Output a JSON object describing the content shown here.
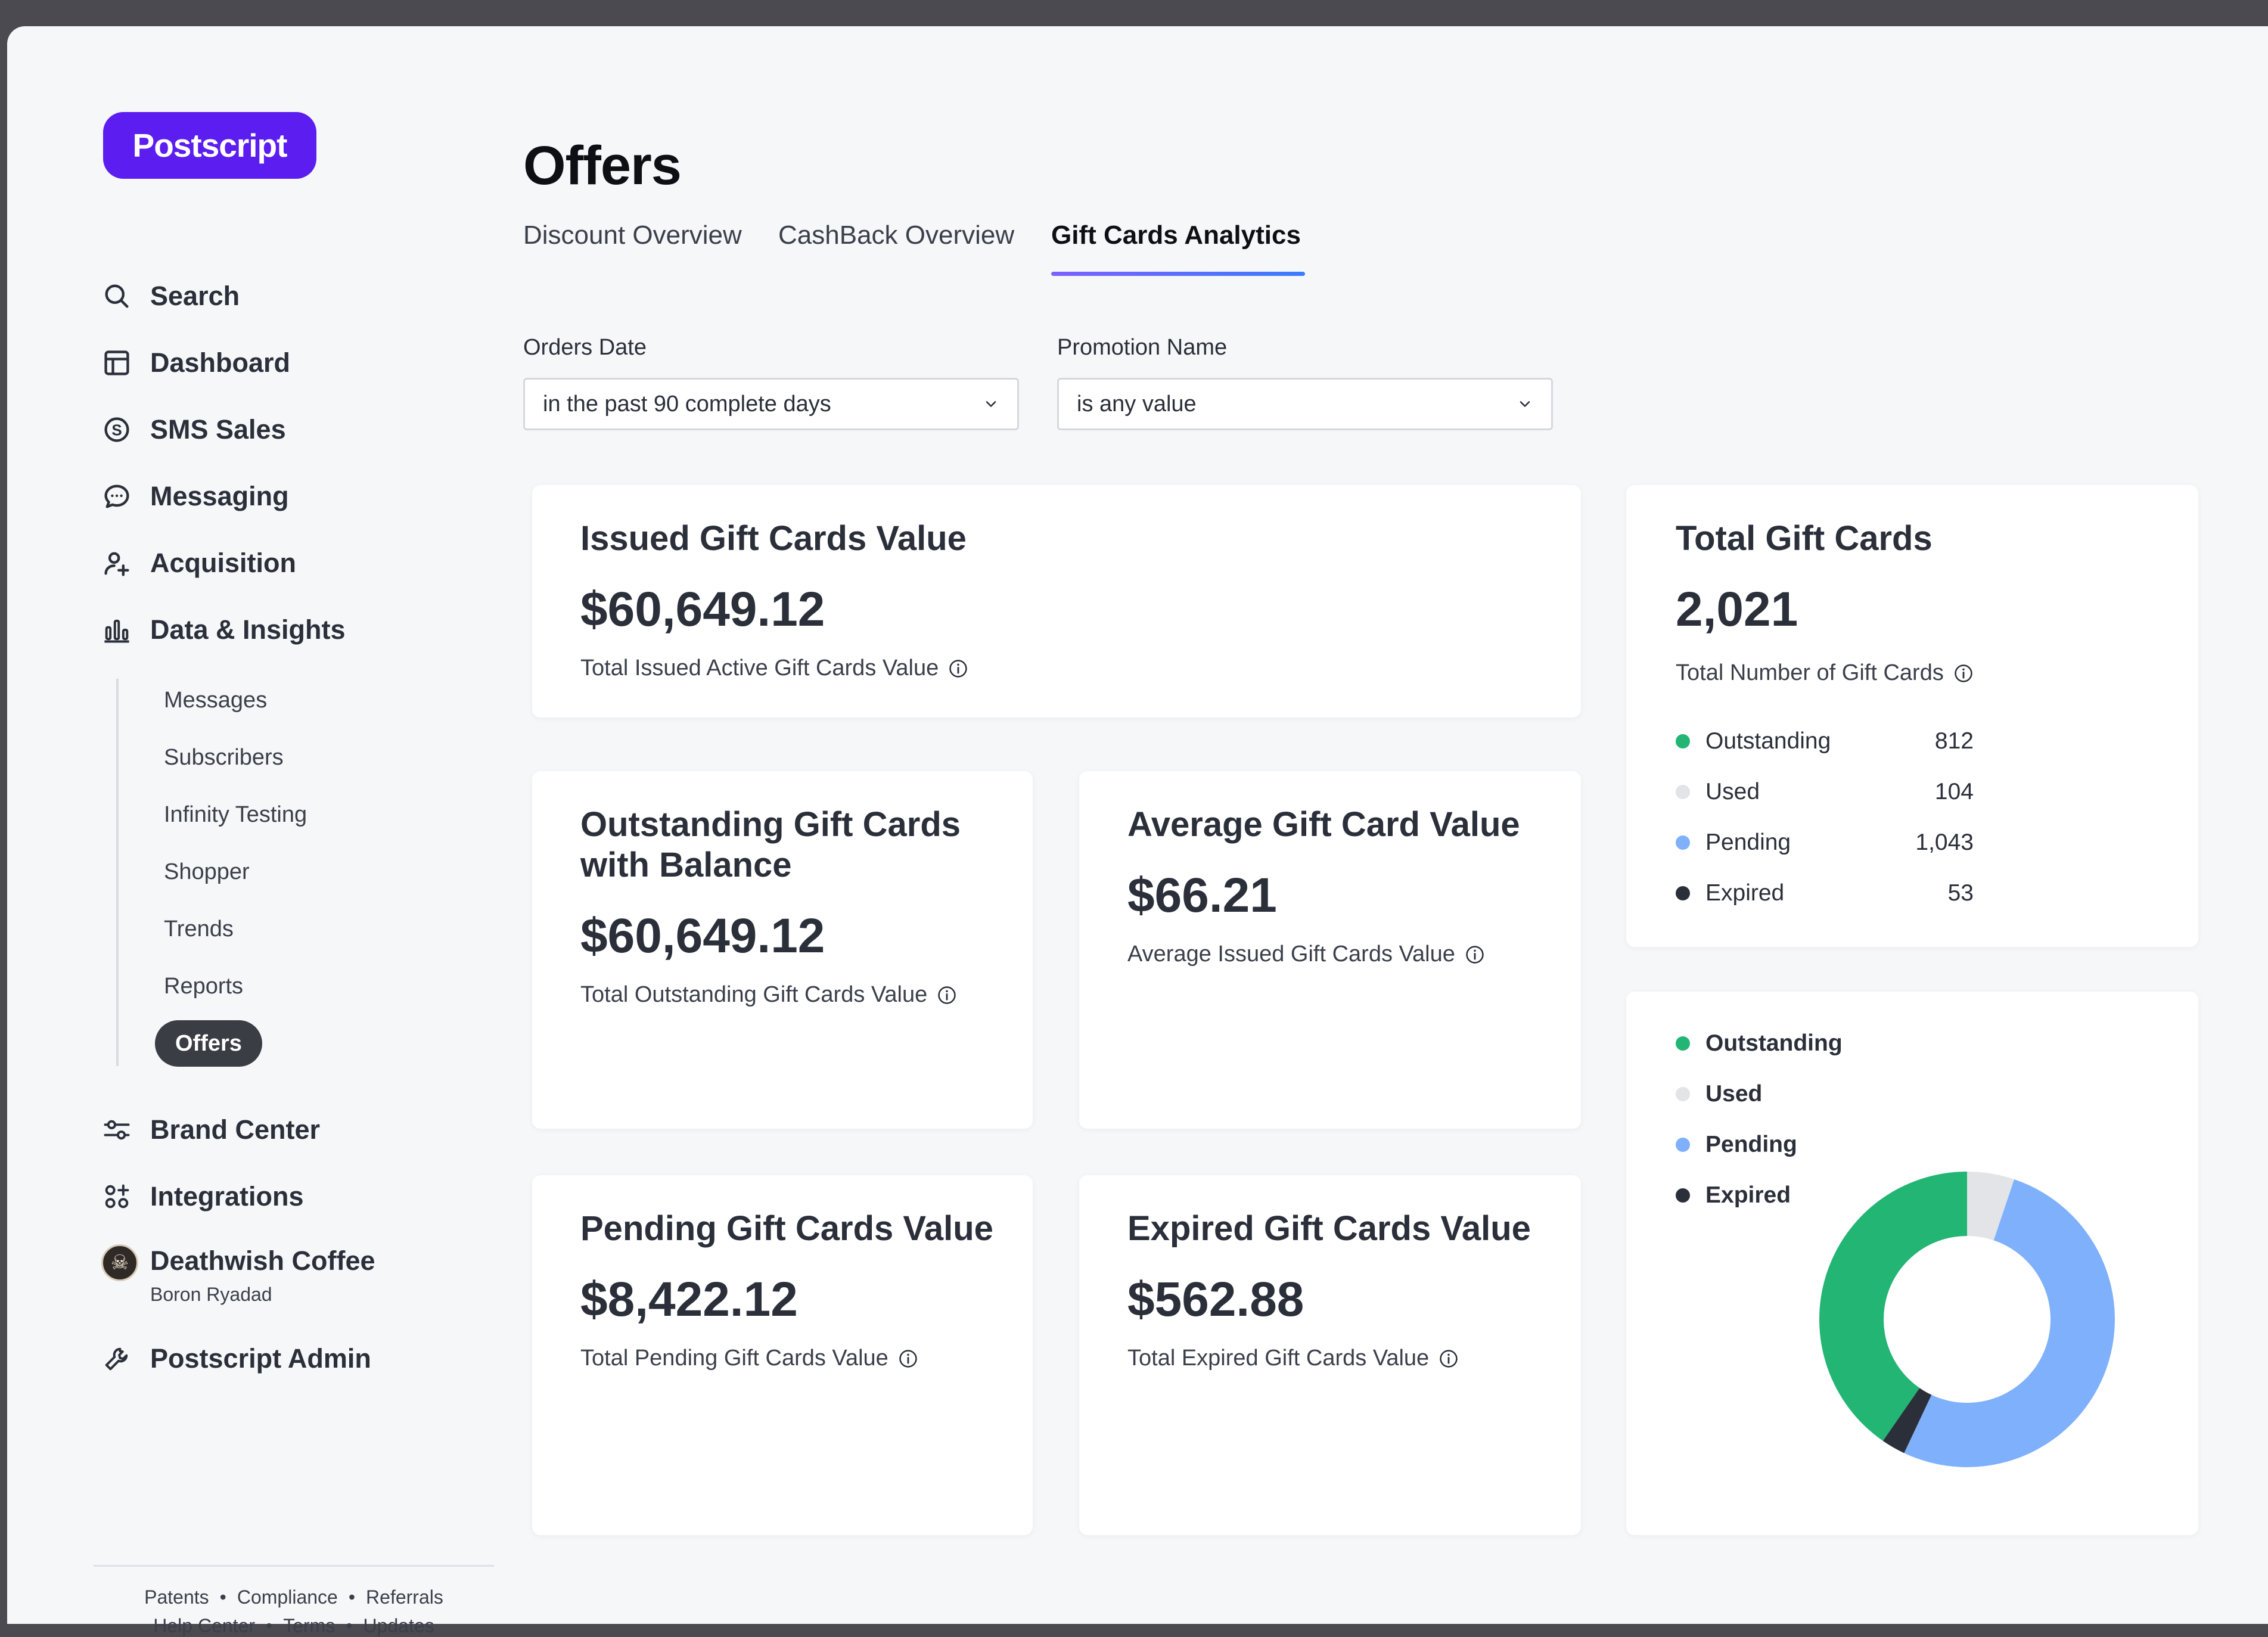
{
  "brand": {
    "logo_text": "Postscript",
    "accent": "#5b1df0"
  },
  "sidebar": {
    "nav": [
      {
        "label": "Search",
        "icon": "search-icon"
      },
      {
        "label": "Dashboard",
        "icon": "dashboard-icon"
      },
      {
        "label": "SMS Sales",
        "icon": "dollar-circle-icon"
      },
      {
        "label": "Messaging",
        "icon": "chat-bubble-icon"
      },
      {
        "label": "Acquisition",
        "icon": "user-add-icon"
      },
      {
        "label": "Data & Insights",
        "icon": "bar-chart-icon"
      }
    ],
    "sub_items": [
      "Messages",
      "Subscribers",
      "Infinity Testing",
      "Shopper",
      "Trends",
      "Reports",
      "Offers"
    ],
    "active_sub_item": "Offers",
    "nav_bottom": [
      {
        "label": "Brand Center",
        "icon": "sliders-icon"
      },
      {
        "label": "Integrations",
        "icon": "apps-add-icon"
      }
    ],
    "account": {
      "name": "Deathwish Coffee",
      "user": "Boron Ryadad",
      "icon": "skull-avatar-icon"
    },
    "admin": {
      "label": "Postscript Admin",
      "icon": "wrench-icon"
    },
    "footer_links_row1": [
      "Patents",
      "Compliance",
      "Referrals"
    ],
    "footer_links_row2": [
      "Help Center",
      "Terms",
      "Updates"
    ],
    "footer_separator": "•"
  },
  "main": {
    "title": "Offers",
    "tabs": [
      {
        "label": "Discount Overview",
        "active": false
      },
      {
        "label": "CashBack Overview",
        "active": false
      },
      {
        "label": "Gift Cards Analytics",
        "active": true
      }
    ],
    "filters": [
      {
        "label": "Orders Date",
        "value": "in the past 90 complete days"
      },
      {
        "label": "Promotion Name",
        "value": "is any value"
      }
    ],
    "cards": {
      "issued": {
        "title": "Issued Gift Cards Value",
        "value": "$60,649.12",
        "subtitle": "Total Issued Active Gift Cards Value"
      },
      "outstanding": {
        "title_line1": "Outstanding Gift Cards",
        "title_line2": "with Balance",
        "value": "$60,649.12",
        "subtitle": "Total Outstanding Gift Cards Value"
      },
      "average": {
        "title": "Average Gift Card Value",
        "value": "$66.21",
        "subtitle": "Average Issued Gift Cards Value"
      },
      "pending": {
        "title": "Pending Gift Cards Value",
        "value": "$8,422.12",
        "subtitle": "Total Pending Gift Cards Value"
      },
      "expired": {
        "title": "Expired Gift Cards Value",
        "value": "$562.88",
        "subtitle": "Total Expired Gift Cards Value"
      },
      "total": {
        "title": "Total Gift Cards",
        "value": "2,021",
        "subtitle": "Total Number of Gift Cards",
        "breakdown": [
          {
            "label": "Outstanding",
            "value": "812",
            "color": "#22b573"
          },
          {
            "label": "Used",
            "value": "104",
            "color": "#e2e4e8"
          },
          {
            "label": "Pending",
            "value": "1,043",
            "color": "#7fb0fb"
          },
          {
            "label": "Expired",
            "value": "53",
            "color": "#2a2f3a"
          }
        ]
      }
    }
  },
  "chart_data": {
    "type": "pie",
    "variant": "donut",
    "legend_position": "top-left",
    "categories": [
      "Outstanding",
      "Used",
      "Pending",
      "Expired"
    ],
    "values": [
      812,
      104,
      1043,
      53
    ],
    "colors": [
      "#22b573",
      "#e2e4e8",
      "#7fb0fb",
      "#2a2f3a"
    ]
  }
}
